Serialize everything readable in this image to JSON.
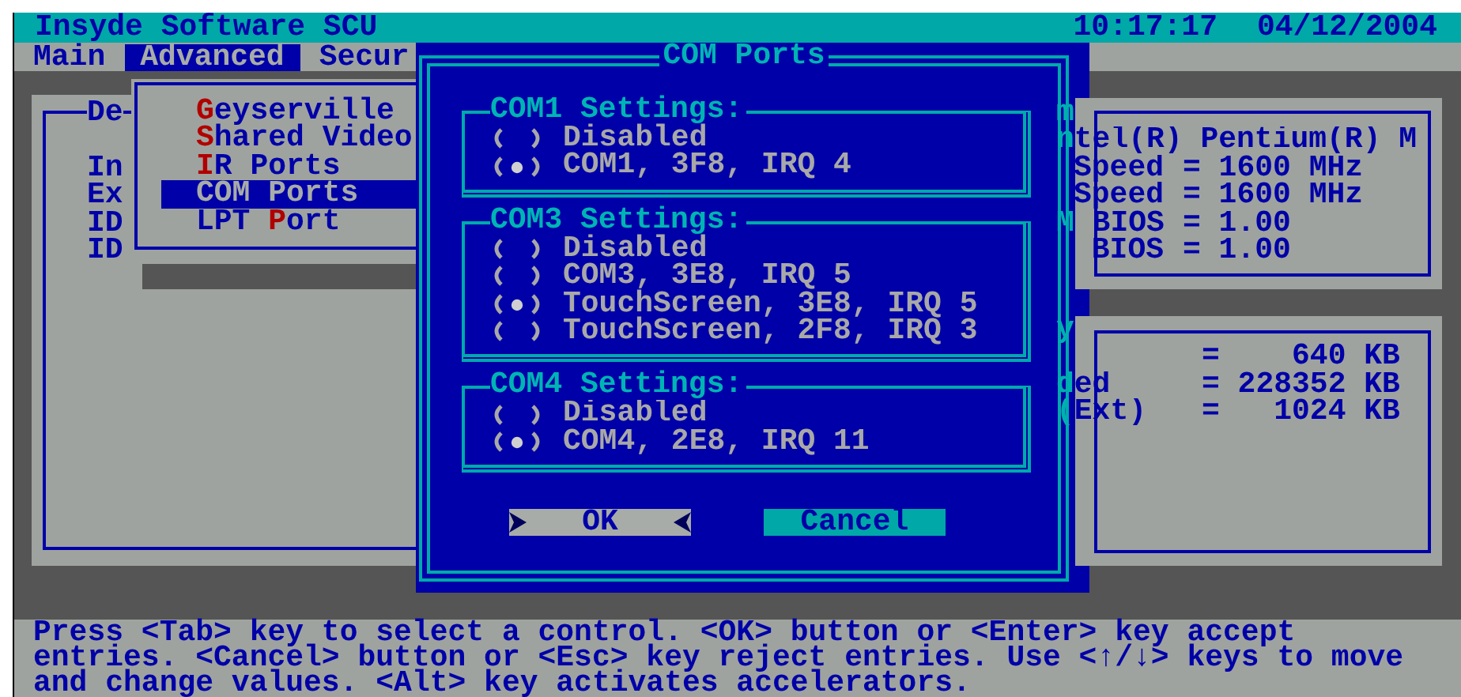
{
  "title_bar": {
    "title": "Insyde Software SCU",
    "time": "10:17:17",
    "date": "04/12/2004"
  },
  "menu_tabs": [
    {
      "label": "Main",
      "selected": false
    },
    {
      "label": "Advanced",
      "selected": true
    },
    {
      "label": "Secur",
      "selected": false
    }
  ],
  "left_panel": {
    "title": "De",
    "rows": [
      "In",
      "Ex",
      "ID",
      "ID"
    ]
  },
  "advanced_menu": [
    {
      "selected": false,
      "parts": [
        {
          "text": "G",
          "hotkey": true
        },
        {
          "text": "eyserville",
          "hotkey": false
        }
      ]
    },
    {
      "selected": false,
      "parts": [
        {
          "text": "S",
          "hotkey": true
        },
        {
          "text": "hared Video",
          "hotkey": false
        }
      ]
    },
    {
      "selected": false,
      "parts": [
        {
          "text": "I",
          "hotkey": true
        },
        {
          "text": "R Ports",
          "hotkey": false
        }
      ]
    },
    {
      "selected": true,
      "parts": [
        {
          "text": "COM Ports",
          "hotkey": false
        }
      ]
    },
    {
      "selected": false,
      "parts": [
        {
          "text": "LPT ",
          "hotkey": false
        },
        {
          "text": "P",
          "hotkey": true
        },
        {
          "text": "ort",
          "hotkey": false
        }
      ]
    }
  ],
  "info_panels": [
    {
      "rows": [
        {
          "label": "m"
        },
        {
          "label": "ntel(R) Pentium(R) M"
        },
        {
          "label": "Speed",
          "value": "= 1600 MHz"
        },
        {
          "label": "Speed",
          "value": "= 1600 MHz"
        },
        {
          "label": "M BIOS",
          "value": "= 1.00"
        },
        {
          "label": "BIOS",
          "value": "= 1.00"
        }
      ]
    },
    {
      "rows": [
        {
          "label": "y"
        },
        {
          "value": "=    640 KB"
        },
        {
          "label": "ded",
          "value": "= 228352 KB"
        },
        {
          "label": "(Ext)",
          "value": "=   1024 KB"
        }
      ]
    }
  ],
  "dialog": {
    "title": "COM Ports",
    "groups": [
      {
        "title": "COM1 Settings:",
        "options": [
          {
            "label": "Disabled",
            "selected": false
          },
          {
            "label": "COM1, 3F8, IRQ 4",
            "selected": true
          }
        ]
      },
      {
        "title": "COM3 Settings:",
        "options": [
          {
            "label": "Disabled",
            "selected": false
          },
          {
            "label": "COM3, 3E8, IRQ 5",
            "selected": false
          },
          {
            "label": "TouchScreen, 3E8, IRQ 5",
            "selected": true
          },
          {
            "label": "TouchScreen, 2F8, IRQ 3",
            "selected": false
          }
        ]
      },
      {
        "title": "COM4 Settings:",
        "options": [
          {
            "label": "Disabled",
            "selected": false
          },
          {
            "label": "COM4, 2E8, IRQ 11",
            "selected": true
          }
        ]
      }
    ],
    "buttons": [
      {
        "label": "OK",
        "focused": true
      },
      {
        "label": "Cancel",
        "focused": false
      }
    ]
  },
  "help_lines": [
    "Press <Tab> key to select a control. <OK> button or <Enter> key accept",
    "entries. <Cancel> button or <Esc> key reject entries. Use <↑/↓> keys to move",
    "and change values. <Alt> key activates accelerators."
  ]
}
